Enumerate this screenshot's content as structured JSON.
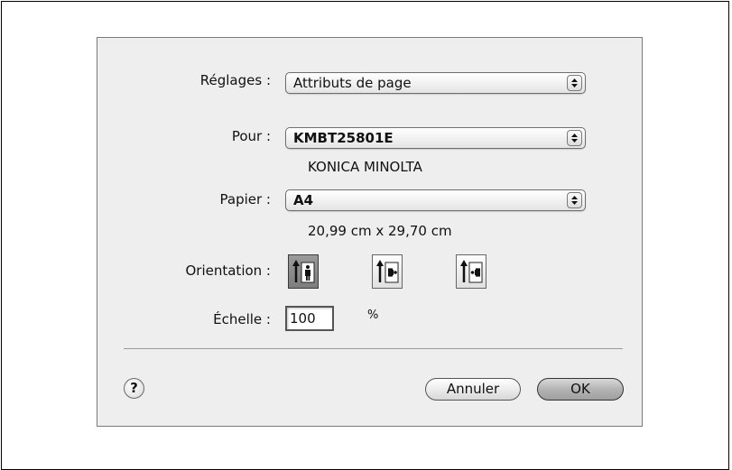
{
  "dialog": {
    "settings": {
      "label": "Réglages :",
      "value": "Attributs de page"
    },
    "format_for": {
      "label": "Pour :",
      "value": "KMBT25801E",
      "subtitle": "KONICA MINOLTA"
    },
    "paper": {
      "label": "Papier :",
      "value": "A4",
      "dimensions": "20,99 cm x 29,70 cm"
    },
    "orientation": {
      "label": "Orientation :",
      "options": [
        "portrait-icon",
        "landscape-left-icon",
        "landscape-right-icon"
      ],
      "selected_index": 0
    },
    "scale": {
      "label": "Échelle :",
      "value": "100",
      "unit": "%"
    },
    "buttons": {
      "help": "?",
      "cancel": "Annuler",
      "ok": "OK"
    }
  }
}
